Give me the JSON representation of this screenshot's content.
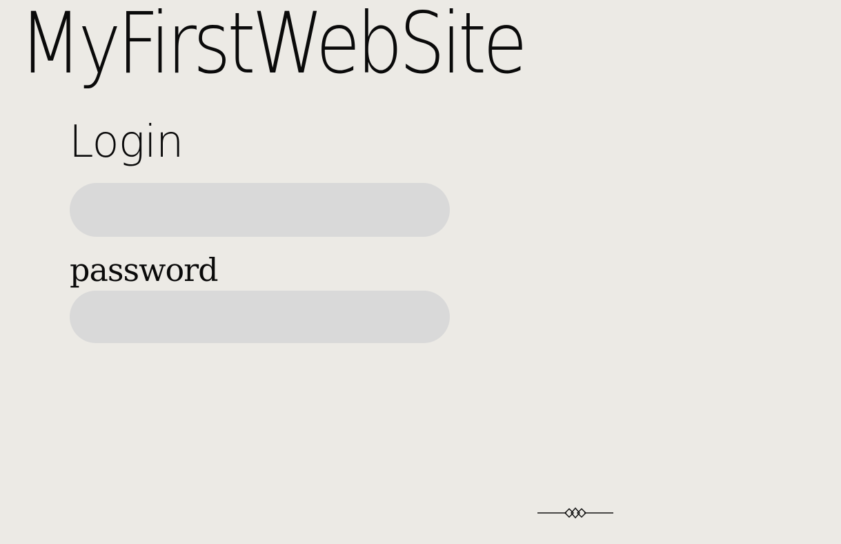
{
  "site": {
    "title": "MyFirstWebSite"
  },
  "login": {
    "heading": "Login",
    "username": {
      "value": "",
      "placeholder": ""
    },
    "password": {
      "label": "password",
      "value": "",
      "placeholder": ""
    }
  },
  "decor": {
    "divider_icon": "diamond-divider-icon"
  },
  "colors": {
    "background": "#ECEAE5",
    "field": "#D9D9D9",
    "text": "#0A0A0A"
  }
}
